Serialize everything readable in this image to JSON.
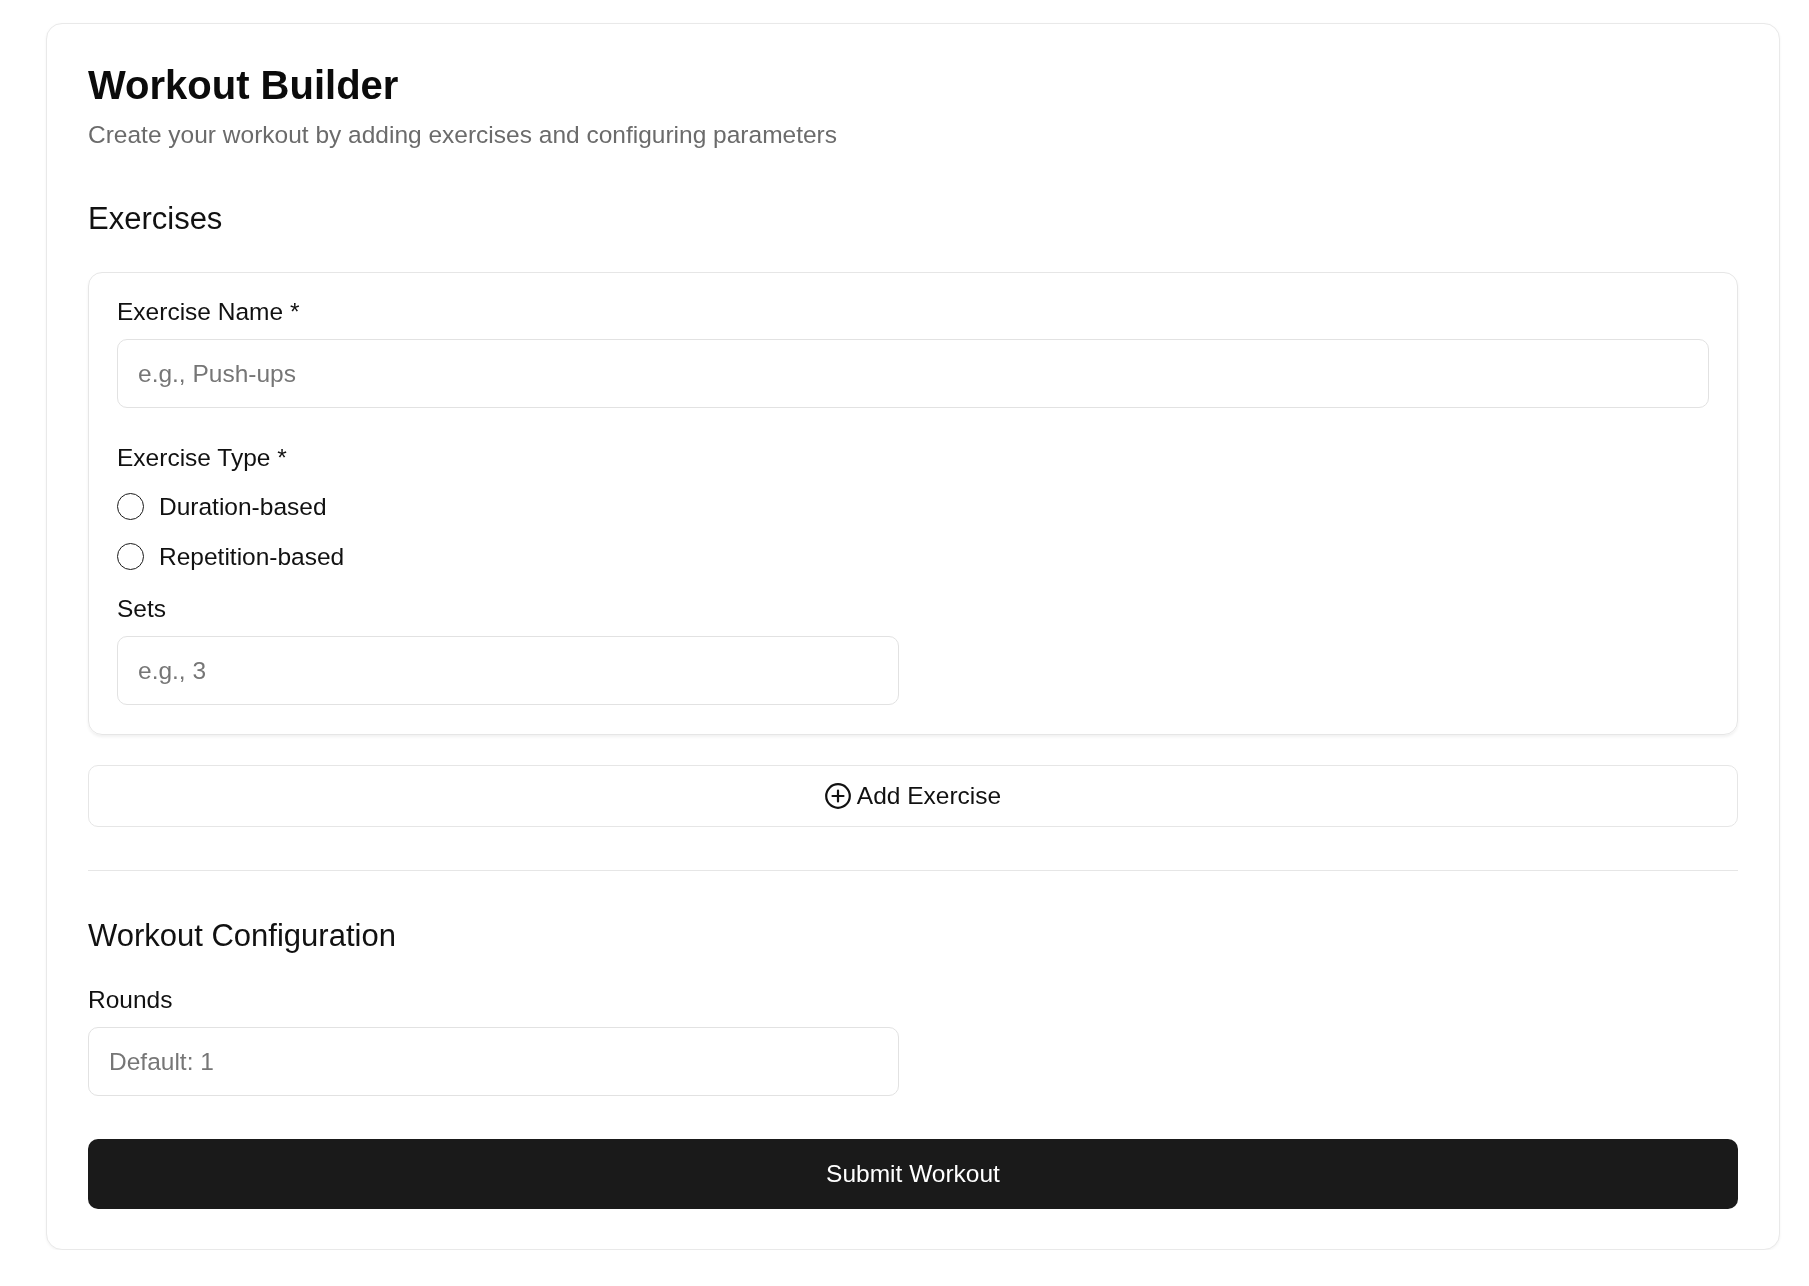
{
  "header": {
    "title": "Workout Builder",
    "subtitle": "Create your workout by adding exercises and configuring parameters"
  },
  "exercises_section": {
    "heading": "Exercises",
    "exercises": [
      {
        "fields": [
          {
            "kind": "text",
            "label": "Exercise Name *",
            "placeholder": "e.g., Push-ups"
          },
          {
            "kind": "radio",
            "label": "Exercise Type *",
            "options": [
              {
                "label": "Duration-based",
                "selected": false
              },
              {
                "label": "Repetition-based",
                "selected": false
              }
            ]
          },
          {
            "kind": "number",
            "label": "Sets",
            "placeholder": "e.g., 3"
          }
        ]
      }
    ],
    "add_button": {
      "label": "Add Exercise"
    }
  },
  "configuration_section": {
    "heading": "Workout Configuration",
    "fields": [
      {
        "kind": "number",
        "label": "Rounds",
        "placeholder": "Default: 1"
      }
    ]
  },
  "submit_button": {
    "label": "Submit Workout"
  }
}
